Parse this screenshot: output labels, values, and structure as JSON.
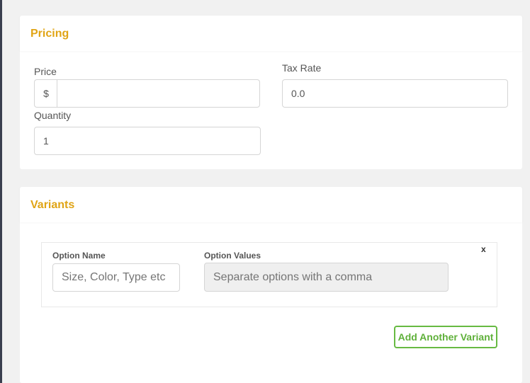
{
  "pricing": {
    "title": "Pricing",
    "price_label": "Price",
    "price_prefix": "$",
    "price_value": "",
    "tax_label": "Tax Rate",
    "tax_value": "0.0",
    "quantity_label": "Quantity",
    "quantity_value": "1"
  },
  "variants": {
    "title": "Variants",
    "option_name_label": "Option Name",
    "option_name_placeholder": "Size, Color, Type etc",
    "option_values_label": "Option Values",
    "option_values_placeholder": "Separate options with a comma",
    "remove_label": "x",
    "add_button_label": "Add Another Variant"
  },
  "colors": {
    "section_title": "#e0a415",
    "add_button": "#67ba42"
  }
}
